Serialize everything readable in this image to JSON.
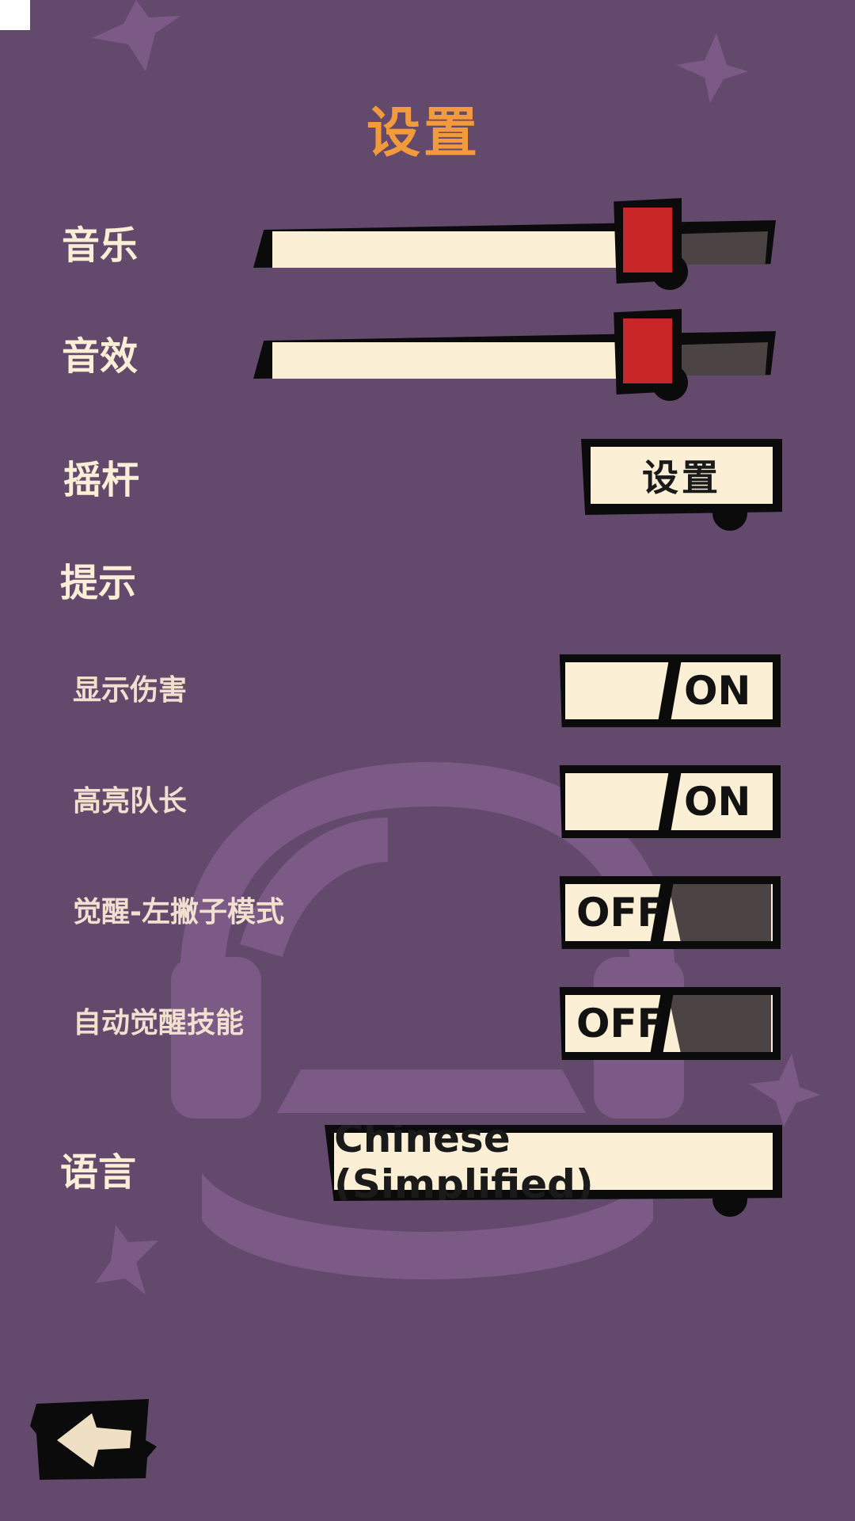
{
  "title": "设置",
  "audio": {
    "music_label": "音乐",
    "music_volume": 0.77,
    "sfx_label": "音效",
    "sfx_volume": 0.77
  },
  "joystick": {
    "label": "摇杆",
    "button_label": "设置"
  },
  "hints": {
    "section_label": "提示",
    "items": [
      {
        "label": "显示伤害",
        "state": "ON"
      },
      {
        "label": "高亮队长",
        "state": "ON"
      },
      {
        "label": "觉醒-左撇子模式",
        "state": "OFF"
      },
      {
        "label": "自动觉醒技能",
        "state": "OFF"
      }
    ]
  },
  "language": {
    "label": "语言",
    "selected": "Chinese (Simplified)"
  },
  "nav": {
    "back_icon": "back-arrow-icon"
  },
  "colors": {
    "background": "#634a6d",
    "title": "#f39a3c",
    "cream": "#fbf0d6",
    "thumb": "#c92727",
    "dark": "#4c4444"
  }
}
